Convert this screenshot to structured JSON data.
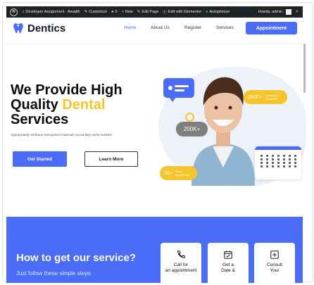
{
  "admin_bar": {
    "site": "Developer Assignment - Awajith",
    "customize": "Customize",
    "comments": "0",
    "new": "New",
    "edit_page": "Edit Page",
    "elementor": "Edit with Elementor",
    "autoptimize": "Autoptimize",
    "howdy": "Howdy, admin"
  },
  "header": {
    "logo": "Dentics",
    "nav": [
      "Home",
      "About Us",
      "Register",
      "Services"
    ],
    "cta": "Appointment"
  },
  "hero": {
    "title_line1": "We Provide High",
    "title_line2_a": "Quality ",
    "title_line2_b": "Dental",
    "title_line3": "Services",
    "subtitle": "Appropriately embrace transparent materials via turnkey niche markets.",
    "btn_start": "Get Started",
    "btn_more": "Learn More",
    "badge_grey": "200K+",
    "badge_y1": "200K+",
    "badge_y1_small": "Successful Treatment",
    "badge_y2": "30+",
    "badge_y2_small": "Years Experience"
  },
  "service": {
    "title": "How to get our service?",
    "subtitle": "Just follow these simple steps",
    "cards": [
      {
        "icon": "phone-icon",
        "line1": "Call for",
        "line2": "an appointment"
      },
      {
        "icon": "calendar-check-icon",
        "line1": "Get a",
        "line2": "Date &"
      },
      {
        "icon": "plus-square-icon",
        "line1": "Consult",
        "line2": "Your"
      }
    ]
  },
  "colors": {
    "primary": "#4a6cf7",
    "accent": "#f6c52c",
    "admin_bar": "#1d2327"
  }
}
